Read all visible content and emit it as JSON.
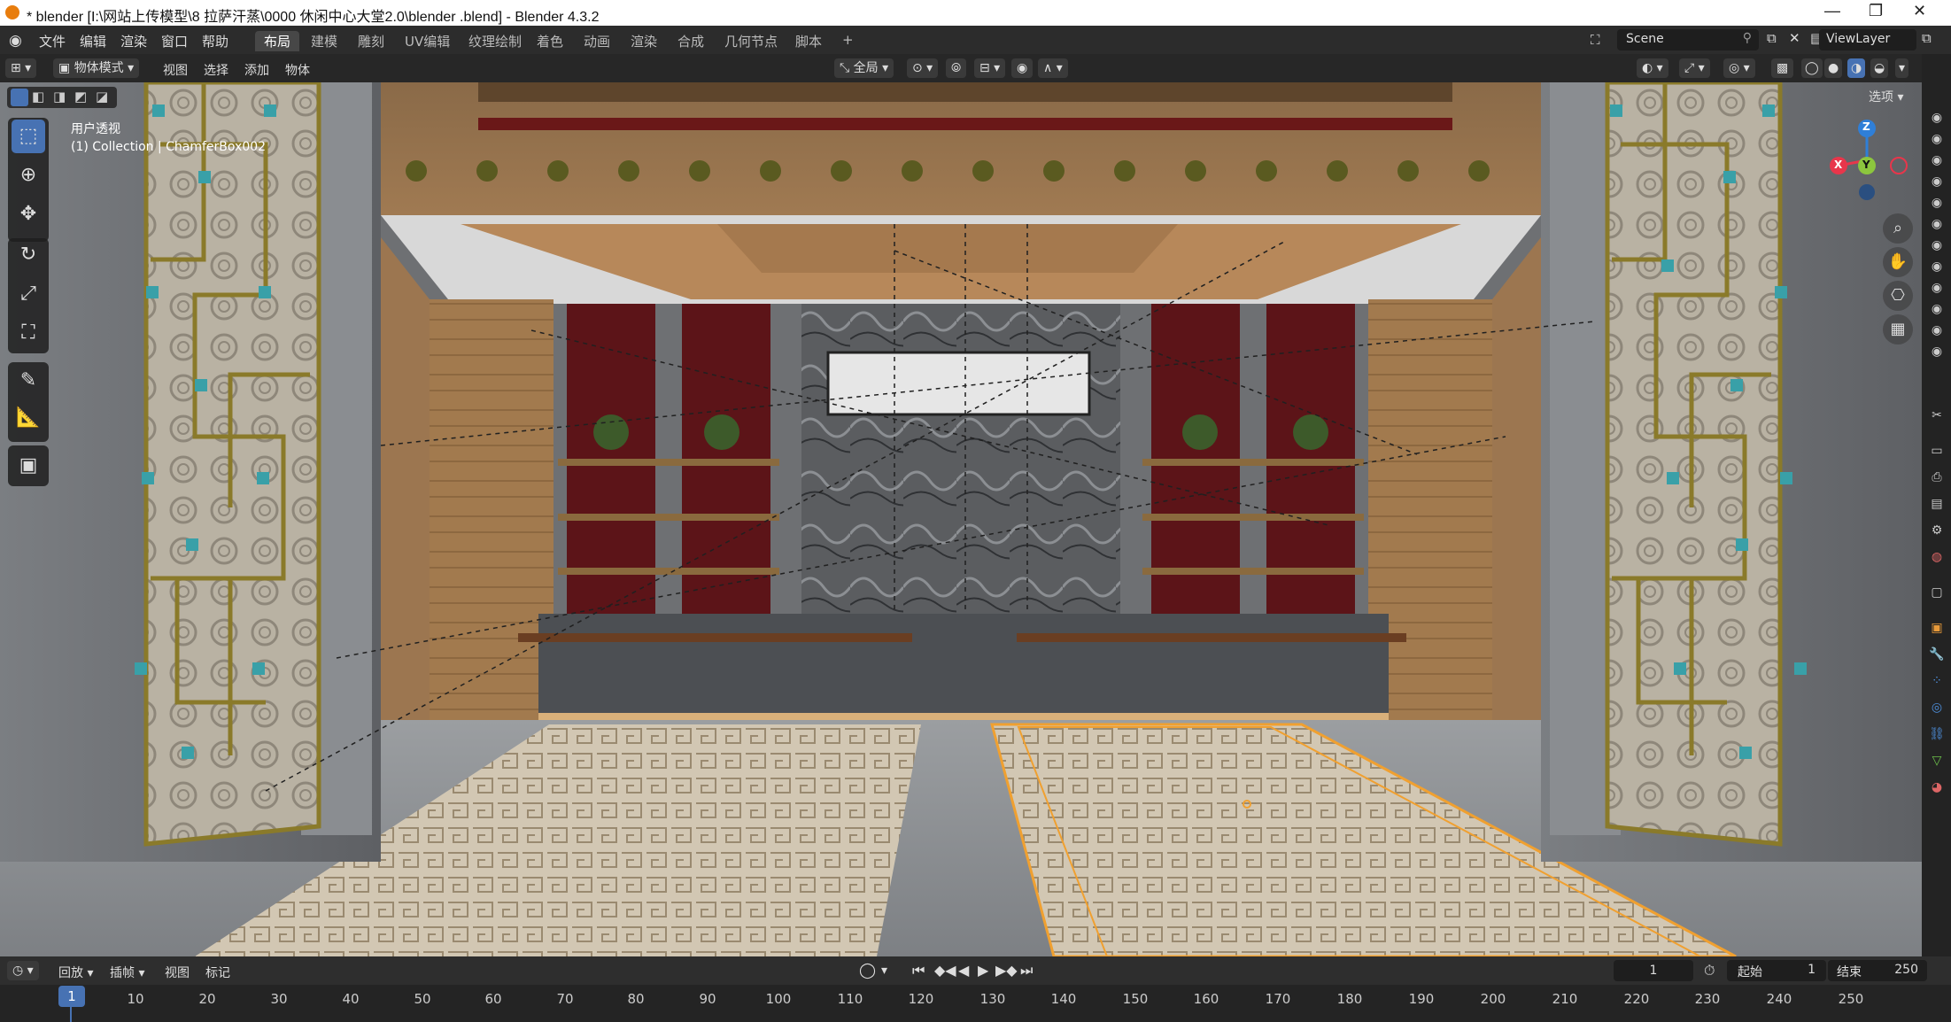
{
  "window": {
    "title": "* blender  [I:\\网站上传模型\\8 拉萨汗蒸\\0000 休闲中心大堂2.0\\blender .blend] - Blender 4.3.2"
  },
  "menu": [
    "文件",
    "编辑",
    "渲染",
    "窗口",
    "帮助"
  ],
  "workspaces": [
    "布局",
    "建模",
    "雕刻",
    "UV编辑",
    "纹理绘制",
    "着色",
    "动画",
    "渲染",
    "合成",
    "几何节点",
    "脚本"
  ],
  "add_workspace": "+",
  "scene": {
    "name": "Scene",
    "view_layer": "ViewLayer"
  },
  "header": {
    "mode": "物体模式",
    "menus": [
      "视图",
      "选择",
      "添加",
      "物体"
    ],
    "orientation": "全局",
    "options_label": "选项"
  },
  "viewport": {
    "view_name": "用户透视",
    "collection_info": "(1) Collection | ChamferBox002",
    "gizmo": {
      "x": "X",
      "y": "Y",
      "z": "Z"
    }
  },
  "tools": [
    "select-box",
    "cursor",
    "move",
    "rotate",
    "scale",
    "transform",
    "annotate",
    "measure",
    "add-cube"
  ],
  "timeline": {
    "menus": [
      "回放",
      "插帧",
      "视图",
      "标记"
    ],
    "current_frame": "1",
    "start_label": "起始",
    "start_value": "1",
    "end_label": "结束",
    "end_value": "250",
    "ticks": [
      "1",
      "10",
      "20",
      "30",
      "40",
      "50",
      "60",
      "70",
      "80",
      "90",
      "100",
      "110",
      "120",
      "130",
      "140",
      "150",
      "160",
      "170",
      "180",
      "190",
      "200",
      "210",
      "220",
      "230",
      "240",
      "250"
    ]
  },
  "colors": {
    "accent": "#4772b3",
    "selection_outline": "#f0a030",
    "header_bg": "#2c2c2c",
    "gizmo_x": "#e8364b",
    "gizmo_y": "#8cc63e",
    "gizmo_z": "#2f7fd8"
  }
}
